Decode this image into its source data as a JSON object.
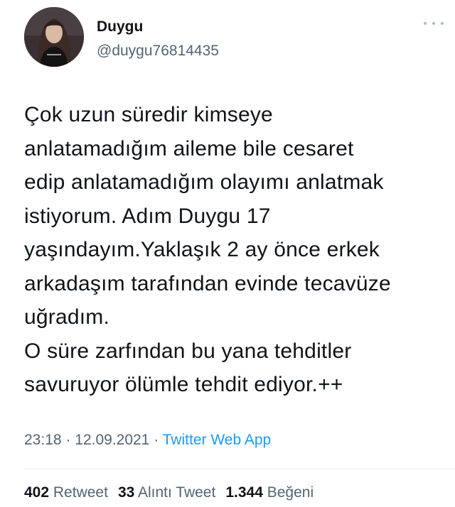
{
  "author": {
    "name": "Duygu",
    "handle": "@duygu76814435"
  },
  "tweet": {
    "lines": [
      "Çok uzun süredir kimseye",
      "anlatamadığım aileme bile cesaret",
      "edip anlatamadığım olayımı anlatmak",
      "istiyorum. Adım Duygu 17",
      "yaşındayım.Yaklaşık 2 ay önce erkek",
      "arkadaşım tarafından evinde tecavüze",
      "uğradım.",
      "O süre zarfından bu yana tehditler",
      "savuruyor ölümle tehdit ediyor.++"
    ]
  },
  "meta": {
    "time": "23:18",
    "separator": "·",
    "date": "12.09.2021",
    "source": "Twitter Web App"
  },
  "stats": {
    "retweets_count": "402",
    "retweets_label": "Retweet",
    "quotes_count": "33",
    "quotes_label": "Alıntı Tweet",
    "likes_count": "1.344",
    "likes_label": "Beğeni"
  },
  "icons": {
    "more": "more-horizontal-icon",
    "avatar": "profile-photo"
  },
  "colors": {
    "text": "#0f1419",
    "secondary": "#536471",
    "link": "#1d9bf0"
  }
}
